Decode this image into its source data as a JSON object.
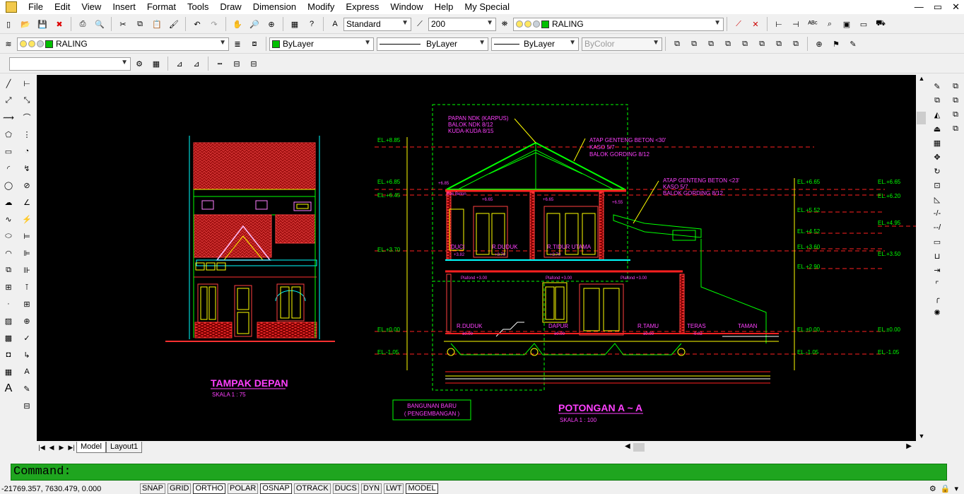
{
  "app": {
    "menus": [
      "File",
      "Edit",
      "View",
      "Insert",
      "Format",
      "Tools",
      "Draw",
      "Dimension",
      "Modify",
      "Express",
      "Window",
      "Help",
      "My Special"
    ]
  },
  "toolbar1": {
    "text_style": "Standard",
    "dim_value": "200",
    "layer": "RALING"
  },
  "toolbar2": {
    "layer": "RALING",
    "color": "ByLayer",
    "linetype": "ByLayer",
    "lineweight": "ByLayer",
    "plotstyle": "ByColor"
  },
  "tabs": {
    "model": "Model",
    "layout1": "Layout1"
  },
  "command": {
    "prompt": "Command:"
  },
  "status": {
    "coords": "-21769.357, 7630.479, 0.000",
    "buttons": [
      "SNAP",
      "GRID",
      "ORTHO",
      "POLAR",
      "OSNAP",
      "OTRACK",
      "DUCS",
      "DYN",
      "LWT",
      "MODEL"
    ],
    "on_buttons": [
      "ORTHO",
      "OSNAP",
      "MODEL"
    ]
  },
  "drawing": {
    "front_title": "TAMPAK DEPAN",
    "front_scale": "SKALA 1 : 75",
    "section_title": "POTONGAN A ~ A",
    "section_scale": "SKALA 1 : 100",
    "new_building_1": "BANGUNAN BARU",
    "new_building_2": "( PENGEMBANGAN )",
    "roof_notes_1": [
      "PAPAN NDK (KARPUS)",
      "BALOK NDK 8/12",
      "KUDA-KUDA 8/15"
    ],
    "roof_notes_2": [
      "ATAP GENTENG BETON <30'",
      "KASO 5/7",
      "BALOK GORDING 8/12"
    ],
    "roof_notes_3": [
      "ATAP GENTENG BETON <23'",
      "KASO 5/7",
      "BALOK GORDING 8/12"
    ],
    "left_levels": [
      "EL.+8.85",
      "EL.+6.85",
      "EL.+6.45",
      "EL.+3.70",
      "EL.±0.00",
      "EL.-1.05"
    ],
    "mid_levels": [
      "EL.+6.65",
      "EL.+5.52",
      "EL.+4.52",
      "EL.+3.60",
      "EL.+2.90",
      "EL.±0.00",
      "EL.-1.05"
    ],
    "right_levels": [
      "EL.+6.65",
      "EL.+6.20",
      "EL.+4.95",
      "EL.+3.50",
      "EL.±0.00",
      "EL.-1.05"
    ],
    "rooms_upper": [
      "DUCI",
      "R.DUDUK",
      "R.TIDUR UTAMA"
    ],
    "rooms_upper_el": [
      "+3.82",
      "+3.70",
      "+3.70"
    ],
    "rooms_lower": [
      "R.DUDUK",
      "DAPUR",
      "R.TAMU",
      "TERAS",
      "TAMAN"
    ],
    "rooms_lower_el": [
      "±0.00",
      "±0.00",
      "±0.00",
      "-0.02"
    ],
    "ceiling": [
      "Plafond +3.00",
      "Plafond +3.00",
      "Plafond +3.00"
    ],
    "small_labels": [
      "+6.85",
      "Bok Beton",
      "+6.65",
      "+6.65",
      "+6.55"
    ]
  }
}
